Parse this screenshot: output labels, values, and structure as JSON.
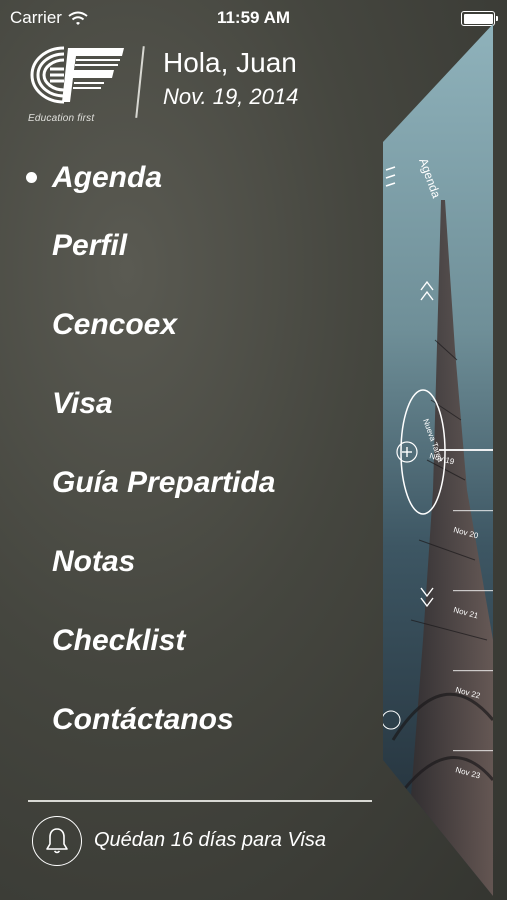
{
  "status_bar": {
    "carrier": "Carrier",
    "time": "11:59 AM"
  },
  "header": {
    "logo_text": "Education first",
    "greeting": "Hola, Juan",
    "date": "Nov. 19, 2014"
  },
  "menu": {
    "items": [
      {
        "label": "Agenda",
        "active": true
      },
      {
        "label": "Perfil",
        "active": false
      },
      {
        "label": "Cencoex",
        "active": false
      },
      {
        "label": "Visa",
        "active": false
      },
      {
        "label": "Guía Prepartida",
        "active": false
      },
      {
        "label": "Notas",
        "active": false
      },
      {
        "label": "Checklist",
        "active": false
      },
      {
        "label": "Contáctanos",
        "active": false
      }
    ]
  },
  "footer": {
    "icon": "bell-icon",
    "reminder": "Quédan 16 días para Visa"
  },
  "preview": {
    "title": "Agenda",
    "new_task": "Nueva Tarea",
    "dates": [
      "Nov 19",
      "Nov 20",
      "Nov 21",
      "Nov 22",
      "Nov 23"
    ]
  },
  "colors": {
    "background": "#45463f",
    "text": "#ffffff",
    "preview_sky": "#6f8f98"
  }
}
